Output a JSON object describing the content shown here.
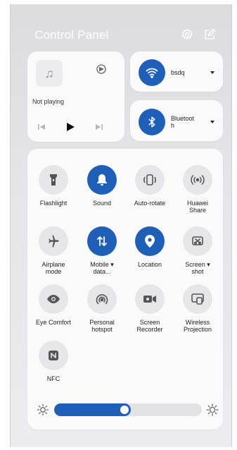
{
  "header": {
    "title": "Control Panel",
    "settings_icon": "gear-icon",
    "edit_icon": "edit-icon"
  },
  "media": {
    "status": "Not playing",
    "art_icon": "music-note-icon",
    "cast_icon": "cast-icon"
  },
  "wifi": {
    "name": "bsdq"
  },
  "bluetooth": {
    "label_line1": "Bluetoot",
    "label_line2": "h"
  },
  "tiles": [
    {
      "label": "Flashlight",
      "icon": "flashlight-icon",
      "active": false
    },
    {
      "label": "Sound",
      "icon": "bell-icon",
      "active": true
    },
    {
      "label": "Auto-rotate",
      "icon": "rotate-icon",
      "active": false
    },
    {
      "label_line1": "Huawei",
      "label_line2": "Share",
      "icon": "share-waves-icon",
      "active": false
    },
    {
      "label_line1": "Airplane",
      "label_line2": "mode",
      "icon": "airplane-icon",
      "active": false
    },
    {
      "label_line1": "Mobile ▾",
      "label_line2": "data...",
      "icon": "mobile-data-icon",
      "active": true
    },
    {
      "label": "Location",
      "icon": "location-pin-icon",
      "active": true
    },
    {
      "label_line1": "Screen ▾",
      "label_line2": "shot",
      "icon": "screenshot-icon",
      "active": false
    },
    {
      "label": "Eye Comfort",
      "icon": "eye-icon",
      "active": false
    },
    {
      "label_line1": "Personal",
      "label_line2": "hotspot",
      "icon": "hotspot-icon",
      "active": false
    },
    {
      "label_line1": "Screen",
      "label_line2": "Recorder",
      "icon": "screen-recorder-icon",
      "active": false
    },
    {
      "label_line1": "Wireless",
      "label_line2": "Projection",
      "icon": "projection-icon",
      "active": false
    },
    {
      "label": "NFC",
      "icon": "nfc-icon",
      "active": false
    }
  ],
  "brightness": {
    "level": 0.52
  },
  "colors": {
    "accent": "#1f5fb8",
    "tile_bg": "#e6e6e8",
    "card_bg": "#fafafa"
  }
}
